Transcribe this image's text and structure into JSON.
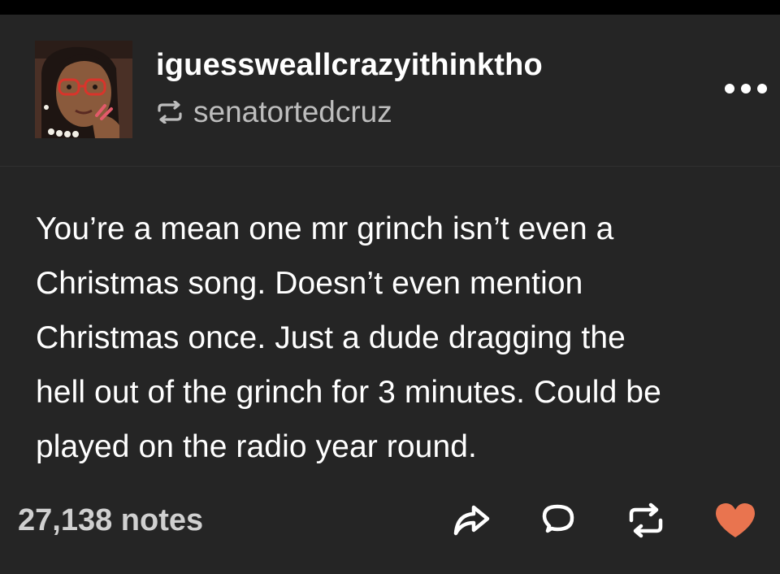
{
  "post": {
    "author": "iguessweallcrazyithinktho",
    "reblogged_from": "senatortedcruz",
    "body_lines": [
      "You’re a mean one mr grinch isn’t even a",
      "Christmas song. Doesn’t even mention",
      "Christmas once. Just a dude dragging the",
      "hell out of the grinch for 3 minutes. Could be",
      "played on the radio year round."
    ],
    "notes_label": "27,138 notes"
  },
  "icons": {
    "reblog_indicator": "reblog-icon",
    "more": "more-icon",
    "share": "share-icon",
    "reply": "reply-icon",
    "reblog": "reblog-icon",
    "like": "heart-icon"
  },
  "colors": {
    "background": "#252525",
    "text": "#ffffff",
    "secondary_text": "#bdbdbd",
    "notes_text": "#d0d0d0",
    "like_color": "#e9744f"
  }
}
